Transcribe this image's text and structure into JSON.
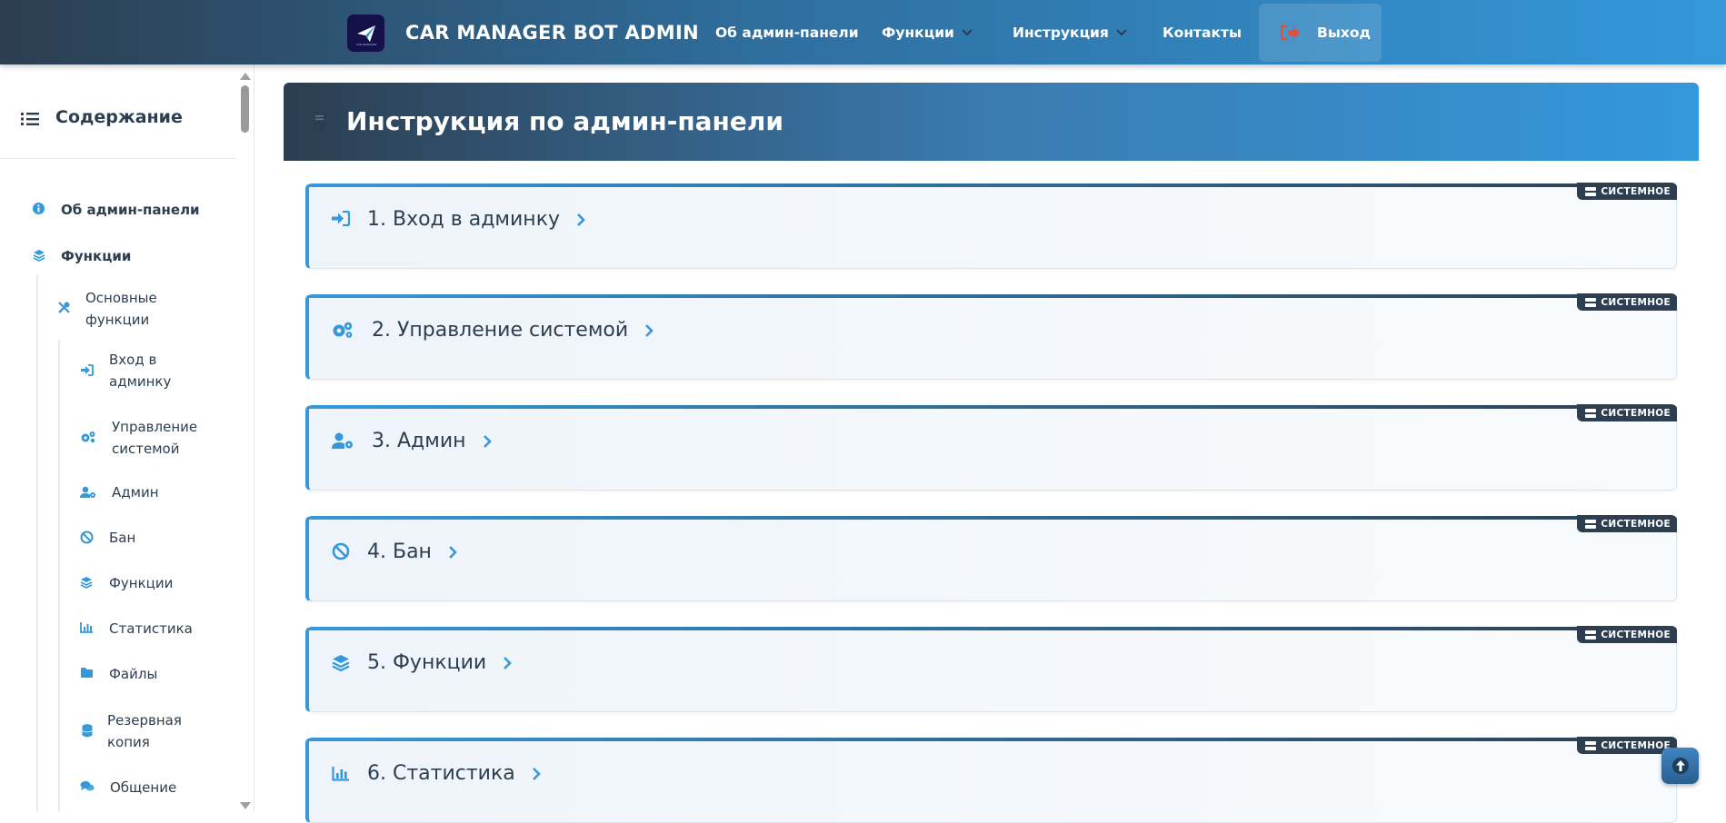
{
  "brand": {
    "title": "CAR MANAGER BOT ADMIN",
    "logo_text": "CAR MANAGER"
  },
  "nav": {
    "about": "Об админ-панели",
    "functions": "Функции",
    "instruction": "Инструкция",
    "contacts": "Контакты",
    "logout": "Выход"
  },
  "sidebar": {
    "title": "Содержание",
    "items": [
      {
        "label": "Об админ-панели",
        "icon": "info-circle-icon"
      },
      {
        "label": "Функции",
        "icon": "layers-icon"
      },
      {
        "label": "Основные функции",
        "icon": "tools-icon"
      },
      {
        "label": "Вход в админку",
        "icon": "sign-in-icon"
      },
      {
        "label": "Управление системой",
        "icon": "cogs-icon"
      },
      {
        "label": "Админ",
        "icon": "user-cog-icon"
      },
      {
        "label": "Бан",
        "icon": "ban-icon"
      },
      {
        "label": "Функции",
        "icon": "layers-icon"
      },
      {
        "label": "Статистика",
        "icon": "chart-bar-icon"
      },
      {
        "label": "Файлы",
        "icon": "folder-icon"
      },
      {
        "label": "Резервная копия",
        "icon": "database-icon"
      },
      {
        "label": "Общение",
        "icon": "comments-icon"
      }
    ]
  },
  "page": {
    "title": "Инструкция по админ-панели"
  },
  "sections": [
    {
      "title": "1. Вход в админку",
      "icon": "sign-in-icon",
      "badge": "СИСТЕМНОЕ"
    },
    {
      "title": "2. Управление системой",
      "icon": "cogs-icon",
      "badge": "СИСТЕМНОЕ"
    },
    {
      "title": "3. Админ",
      "icon": "user-cog-icon",
      "badge": "СИСТЕМНОЕ"
    },
    {
      "title": "4. Бан",
      "icon": "ban-icon",
      "badge": "СИСТЕМНОЕ"
    },
    {
      "title": "5. Функции",
      "icon": "layers-icon",
      "badge": "СИСТЕМНОЕ"
    },
    {
      "title": "6. Статистика",
      "icon": "chart-bar-icon",
      "badge": "СИСТЕМНОЕ"
    }
  ],
  "colors": {
    "primary": "#3498db",
    "dark": "#2c3e50",
    "logout_icon": "#e74c3c"
  }
}
